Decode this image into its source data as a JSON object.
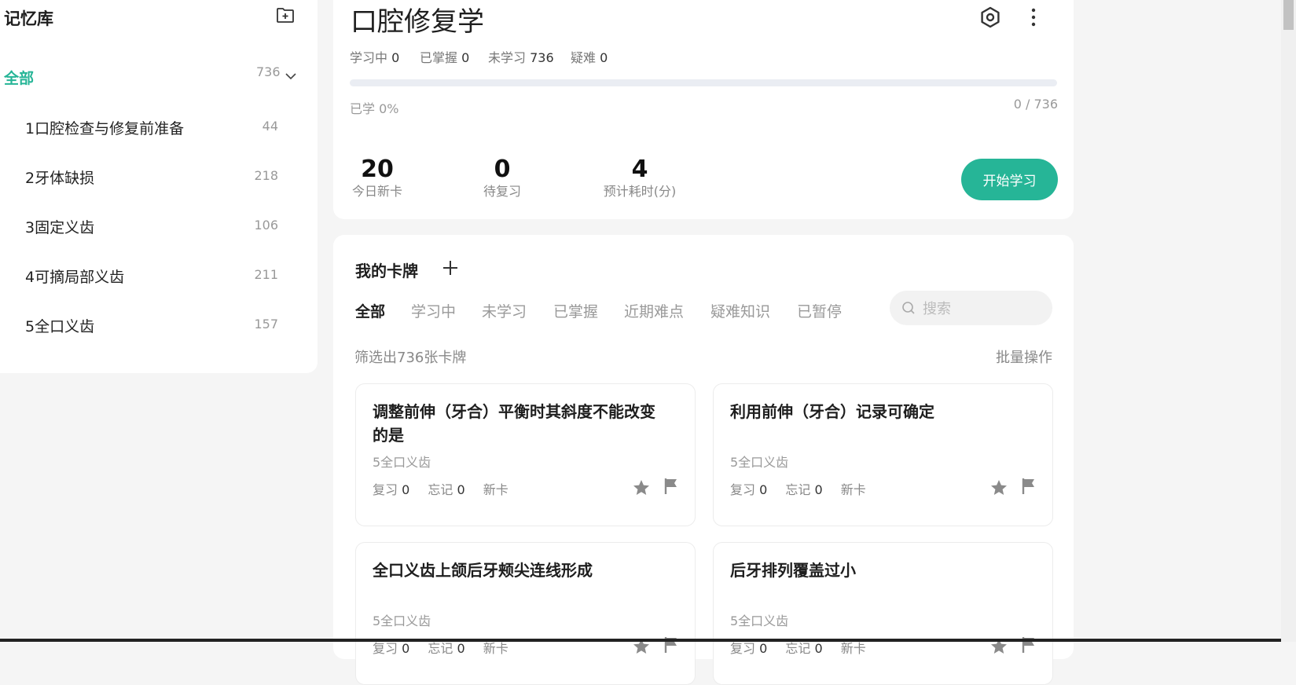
{
  "sidebar": {
    "title": "记忆库",
    "all_label": "全部",
    "all_count": "736",
    "items": [
      {
        "label": "1口腔检查与修复前准备",
        "count": "44"
      },
      {
        "label": "2牙体缺损",
        "count": "218"
      },
      {
        "label": "3固定义齿",
        "count": "106"
      },
      {
        "label": "4可摘局部义齿",
        "count": "211"
      },
      {
        "label": "5全口义齿",
        "count": "157"
      }
    ]
  },
  "deck": {
    "title": "口腔修复学",
    "stats": [
      {
        "label": "学习中",
        "value": "0"
      },
      {
        "label": "已掌握",
        "value": "0"
      },
      {
        "label": "未学习",
        "value": "736"
      },
      {
        "label": "疑难",
        "value": "0"
      }
    ],
    "progress_label": "已学 0%",
    "progress_fraction": 0,
    "progress_count": "0 / 736",
    "big_stats": [
      {
        "value": "20",
        "caption": "今日新卡"
      },
      {
        "value": "0",
        "caption": "待复习"
      },
      {
        "value": "4",
        "caption": "预计耗时(分)"
      }
    ],
    "start_label": "开始学习"
  },
  "cards_panel": {
    "title": "我的卡牌",
    "tabs": [
      "全部",
      "学习中",
      "未学习",
      "已掌握",
      "近期难点",
      "疑难知识",
      "已暂停"
    ],
    "search_placeholder": "搜索",
    "filter_text": "筛选出736张卡牌",
    "batch_label": "批量操作",
    "cards": [
      {
        "question": "调整前伸（牙合）平衡时其斜度不能改变的是",
        "section": "5全口义齿",
        "review_label": "复习",
        "review": "0",
        "forget_label": "忘记",
        "forget": "0",
        "status": "新卡"
      },
      {
        "question": "利用前伸（牙合）记录可确定",
        "section": "5全口义齿",
        "review_label": "复习",
        "review": "0",
        "forget_label": "忘记",
        "forget": "0",
        "status": "新卡"
      },
      {
        "question": "全口义齿上颌后牙颊尖连线形成",
        "section": "5全口义齿",
        "review_label": "复习",
        "review": "0",
        "forget_label": "忘记",
        "forget": "0",
        "status": "新卡"
      },
      {
        "question": "后牙排列覆盖过小",
        "section": "5全口义齿",
        "review_label": "复习",
        "review": "0",
        "forget_label": "忘记",
        "forget": "0",
        "status": "新卡"
      }
    ]
  },
  "colors": {
    "accent": "#26b597",
    "progress_track": "#eaedf3"
  }
}
